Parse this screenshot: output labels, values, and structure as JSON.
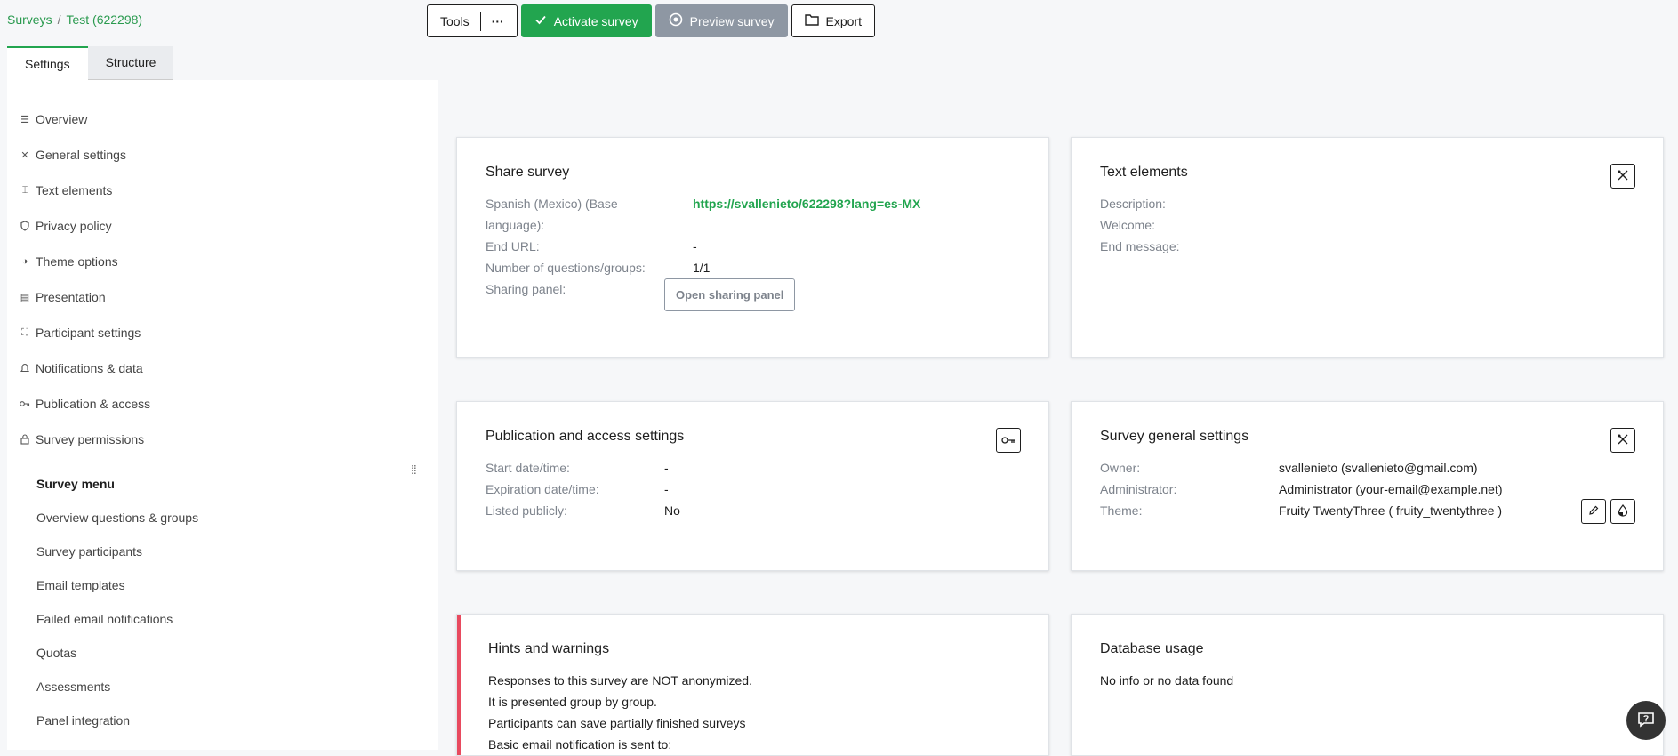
{
  "breadcrumb": {
    "root": "Surveys",
    "separator": "/",
    "current": "Test (622298)"
  },
  "toolbar": {
    "tools_label": "Tools",
    "tools_more": "···",
    "activate_label": "Activate survey",
    "preview_label": "Preview survey",
    "export_label": "Export"
  },
  "tabs": {
    "settings": "Settings",
    "structure": "Structure"
  },
  "sidebar": {
    "items": [
      {
        "label": "Overview",
        "icon": "overview-icon"
      },
      {
        "label": "General settings",
        "icon": "tools-icon"
      },
      {
        "label": "Text elements",
        "icon": "text-icon"
      },
      {
        "label": "Privacy policy",
        "icon": "shield-icon"
      },
      {
        "label": "Theme options",
        "icon": "theme-icon"
      },
      {
        "label": "Presentation",
        "icon": "presentation-icon"
      },
      {
        "label": "Participant settings",
        "icon": "participant-icon"
      },
      {
        "label": "Notifications & data",
        "icon": "bell-icon"
      },
      {
        "label": "Publication & access",
        "icon": "key-icon"
      },
      {
        "label": "Survey permissions",
        "icon": "lock-icon"
      }
    ],
    "menu_title": "Survey menu",
    "menu_items": [
      "Overview questions & groups",
      "Survey participants",
      "Email templates",
      "Failed email notifications",
      "Quotas",
      "Assessments",
      "Panel integration"
    ]
  },
  "share": {
    "title": "Share survey",
    "lang_label_1": "Spanish (Mexico) (Base",
    "lang_label_2": "language):",
    "lang_url": "https://svallenieto/622298?lang=es-MX",
    "end_url_label": "End URL:",
    "end_url_value": "-",
    "questions_label": "Number of questions/groups:",
    "questions_value": "1/1",
    "sharing_label": "Sharing panel:",
    "sharing_button": "Open sharing panel"
  },
  "text_elements": {
    "title": "Text elements",
    "description_label": "Description:",
    "welcome_label": "Welcome:",
    "end_message_label": "End message:"
  },
  "publication": {
    "title": "Publication and access settings",
    "start_label": "Start date/time:",
    "start_value": "-",
    "expiration_label": "Expiration date/time:",
    "expiration_value": "-",
    "listed_label": "Listed publicly:",
    "listed_value": "No"
  },
  "general": {
    "title": "Survey general settings",
    "owner_label": "Owner:",
    "owner_value": "svallenieto (svallenieto@gmail.com)",
    "admin_label": "Administrator:",
    "admin_value": "Administrator (your-email@example.net)",
    "theme_label": "Theme:",
    "theme_value": "Fruity TwentyThree ( fruity_twentythree )"
  },
  "hints": {
    "title": "Hints and warnings",
    "lines": [
      "Responses to this survey are NOT anonymized.",
      "It is presented group by group.",
      "Participants can save partially finished surveys",
      "Basic email notification is sent to:"
    ]
  },
  "database": {
    "title": "Database usage",
    "message": "No info or no data found"
  },
  "colors": {
    "accent": "#22a54f",
    "warning": "#e84a5f",
    "preview": "#8e97a3"
  }
}
